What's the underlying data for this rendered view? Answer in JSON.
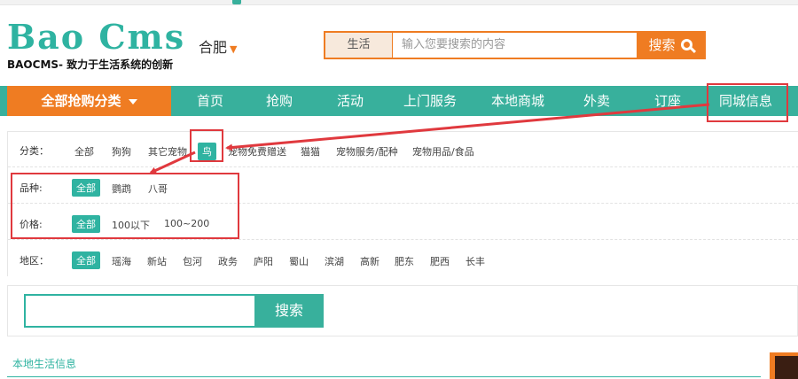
{
  "header": {
    "brand": "Bao Cms",
    "slogan": "BAOCMS- 致力于生活系统的创新",
    "city": "合肥",
    "search": {
      "scope": "生活",
      "placeholder": "输入您要搜索的内容",
      "button": "搜索"
    }
  },
  "nav": {
    "all_categories": "全部抢购分类",
    "items": [
      "首页",
      "抢购",
      "活动",
      "上门服务",
      "本地商城",
      "外卖",
      "订座",
      "同城信息"
    ]
  },
  "filters": {
    "category": {
      "label": "分类：",
      "options": [
        "全部",
        "狗狗",
        "其它宠物",
        "鸟",
        "宠物免费赠送",
        "猫猫",
        "宠物服务/配种",
        "宠物用品/食品"
      ],
      "selected": "鸟"
    },
    "breed": {
      "label": "品种:",
      "options": [
        "全部",
        "鹦鹉",
        "八哥"
      ],
      "selected": "全部"
    },
    "price": {
      "label": "价格:",
      "options": [
        "全部",
        "100以下",
        "100~200"
      ],
      "selected": "全部"
    },
    "area": {
      "label": "地区：",
      "options": [
        "全部",
        "瑶海",
        "新站",
        "包河",
        "政务",
        "庐阳",
        "蜀山",
        "滨湖",
        "高新",
        "肥东",
        "肥西",
        "长丰"
      ],
      "selected": "全部"
    }
  },
  "search2": {
    "value": "",
    "button": "搜索"
  },
  "section": {
    "local_info": "本地生活信息"
  },
  "colors": {
    "teal": "#38b09c",
    "orange": "#ef7c22",
    "annotation_red": "#e0393e"
  },
  "icons": {
    "city_caret": "chevron-down-icon",
    "search": "search-icon",
    "nav_caret": "caret-down-icon"
  }
}
